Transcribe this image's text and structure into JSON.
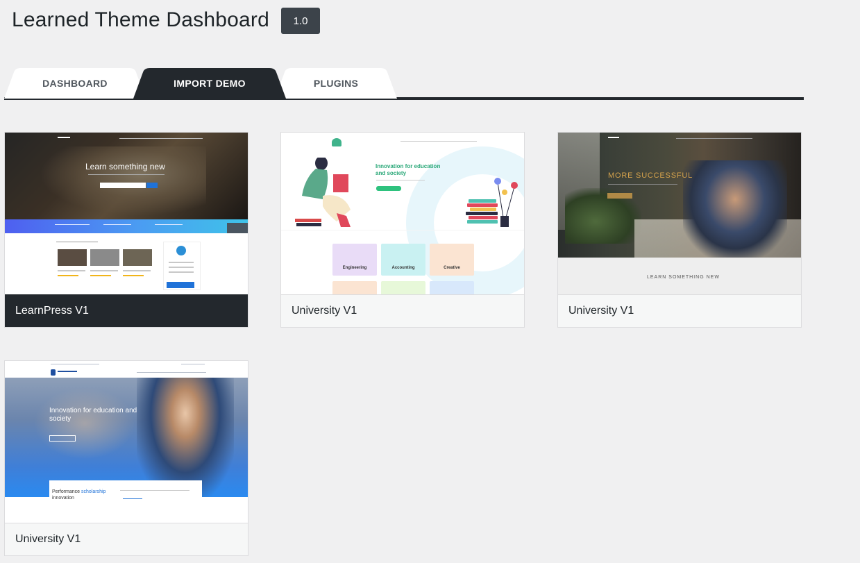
{
  "header": {
    "title": "Learned Theme Dashboard",
    "version": "1.0"
  },
  "tabs": [
    {
      "label": "DASHBOARD",
      "active": false
    },
    {
      "label": "IMPORT DEMO",
      "active": true
    },
    {
      "label": "PLUGINS",
      "active": false
    }
  ],
  "demos": [
    {
      "name": "LearnPress V1",
      "selected": true,
      "preview": {
        "hero_text": "Learn something new"
      }
    },
    {
      "name": "University V1",
      "selected": false,
      "preview": {
        "hero_text": "Innovation for education and society",
        "boxes": [
          "Engineering",
          "Accounting",
          "Creative"
        ]
      }
    },
    {
      "name": "University V1",
      "selected": false,
      "preview": {
        "hero_text": "MORE SUCCESSFUL",
        "section_text": "LEARN SOMETHING NEW"
      }
    },
    {
      "name": "University V1",
      "selected": false,
      "preview": {
        "hero_text": "Innovation for education and society",
        "panel_text": "Performance",
        "panel_highlight": "scholarship",
        "panel_text2": "innovation"
      }
    }
  ],
  "colors": {
    "tab_active": "#23282d",
    "badge": "#3c434a",
    "background": "#f0f0f1"
  }
}
